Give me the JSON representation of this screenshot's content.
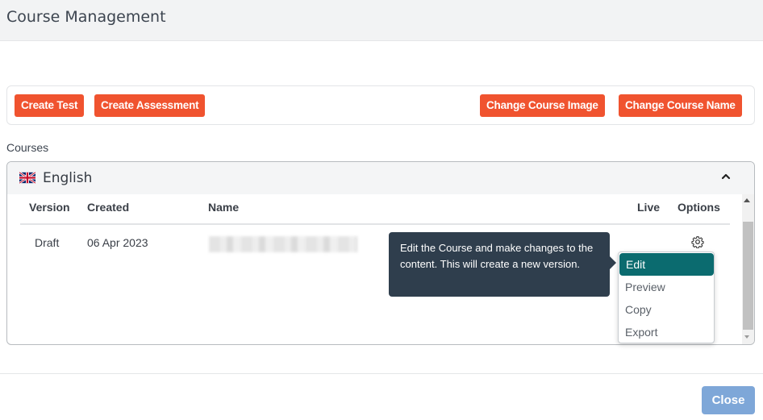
{
  "header": {
    "title": "Course Management"
  },
  "toolbar": {
    "create_test": "Create Test",
    "create_assessment": "Create Assessment",
    "change_image": "Change Course Image",
    "change_name": "Change Course Name"
  },
  "courses_label": "Courses",
  "panel": {
    "language": "English",
    "flag_icon": "uk-flag-icon",
    "collapse_icon": "chevron-up-icon"
  },
  "table": {
    "headers": {
      "version": "Version",
      "created": "Created",
      "name": "Name",
      "live": "Live",
      "options": "Options"
    },
    "rows": [
      {
        "version": "Draft",
        "created": "06 Apr 2023",
        "name": "",
        "live": ""
      }
    ]
  },
  "tooltip": {
    "text": "Edit the Course and make changes to the content. This will create a new version."
  },
  "menu": {
    "items": [
      "Edit",
      "Preview",
      "Copy",
      "Export"
    ],
    "active": "Edit"
  },
  "footer": {
    "close": "Close"
  },
  "colors": {
    "accent": "#f0532f",
    "menu_active": "#0b6b6f",
    "tooltip_bg": "#2f3e4d",
    "close_btn": "#7ea7d8"
  }
}
